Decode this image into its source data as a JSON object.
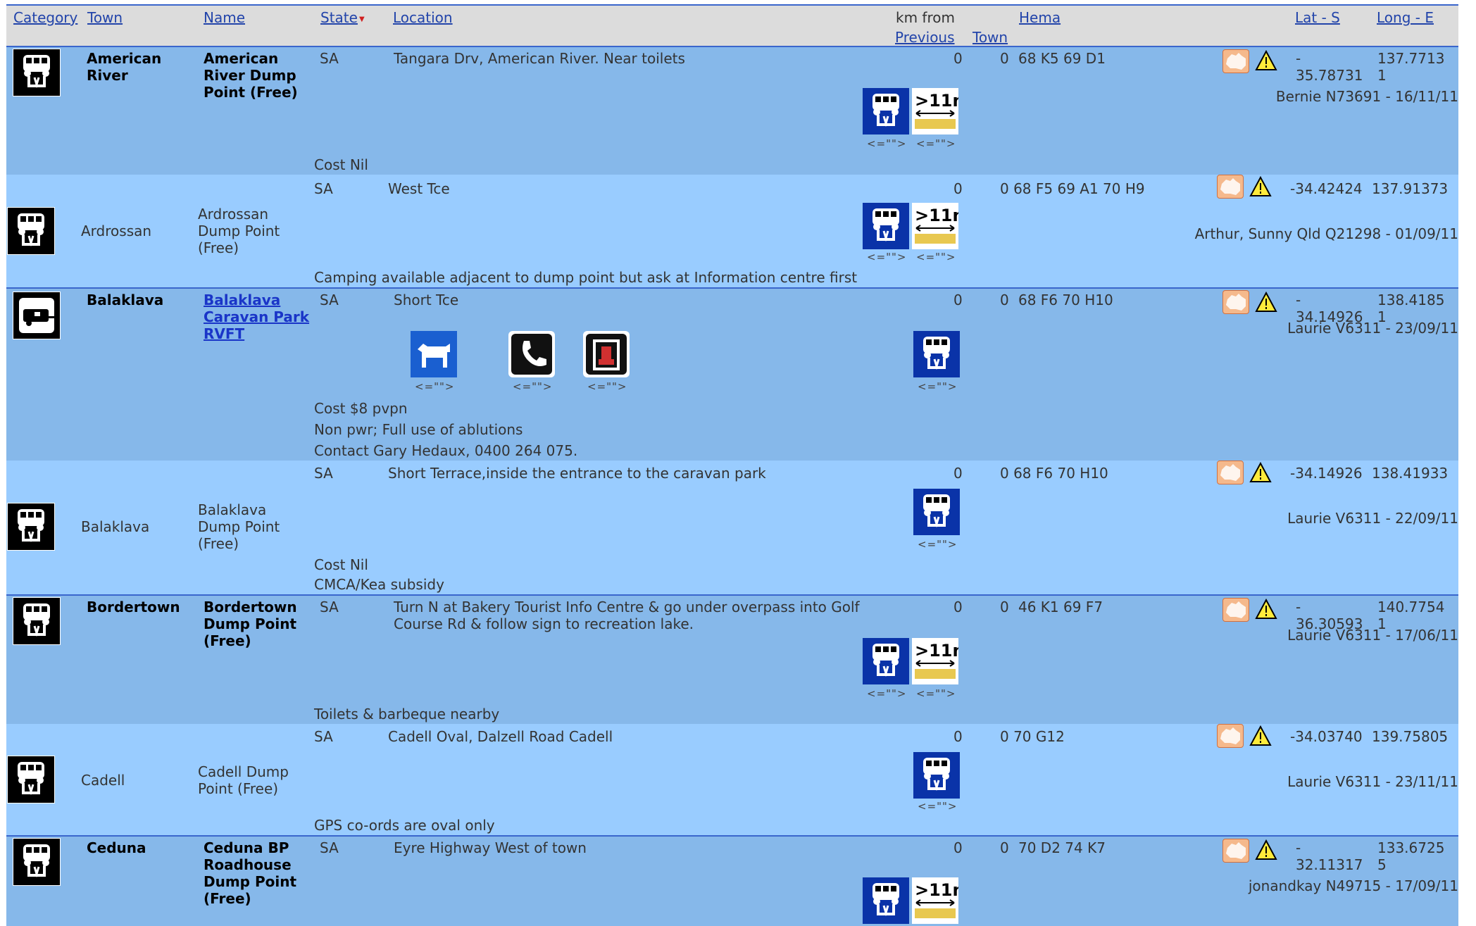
{
  "header": {
    "category": "Category",
    "town": "Town",
    "name": "Name",
    "state": "State",
    "location": "Location",
    "km_from": "km from",
    "previous": "Previous",
    "town2": "Town",
    "hema": "Hema",
    "lat": "Lat - S",
    "long": "Long - E"
  },
  "icon_caption": "<=\"\">",
  "rows": [
    {
      "town": "American River",
      "name": "American River Dump Point (Free)",
      "state": "SA",
      "location": "Tangara Drv, American River. Near toilets",
      "km": "0",
      "prev": "0",
      "hema": "68 K5 69 D1",
      "lat": "-\n35.78731",
      "long": "137.7713\n1",
      "contributor": "Bernie N73691 - 16/11/11",
      "notes": [
        "Cost Nil"
      ]
    },
    {
      "town": "Ardrossan",
      "name": "Ardrossan Dump Point (Free)",
      "state": "SA",
      "location": "West Tce",
      "km": "0",
      "hema": "0 68 F5 69 A1 70 H9",
      "lat": "-34.42424",
      "long": "137.91373",
      "contributor": "Arthur, Sunny Qld Q21298 - 01/09/11",
      "notes": [
        "Camping available adjacent to dump point but ask at Information centre first"
      ]
    },
    {
      "town": "Balaklava",
      "name": "Balaklava Caravan Park RVFT",
      "state": "SA",
      "location": "Short Tce",
      "km": "0",
      "prev": "0",
      "hema": "68 F6 70 H10",
      "lat": "-\n34.14926",
      "long": "138.4185\n1",
      "contributor": "Laurie V6311 - 23/09/11",
      "notes": [
        "Cost $8 pvpn",
        "Non pwr;  Full use of ablutions",
        "Contact Gary Hedaux, 0400 264 075."
      ]
    },
    {
      "town": "Balaklava",
      "name": "Balaklava Dump Point (Free)",
      "state": "SA",
      "location": "Short Terrace,inside the entrance to the caravan park",
      "km": "0",
      "hema": "0 68 F6 70 H10",
      "lat": "-34.14926",
      "long": "138.41933",
      "contributor": "Laurie V6311 - 22/09/11",
      "notes": [
        "Cost Nil",
        "CMCA/Kea subsidy"
      ]
    },
    {
      "town": "Bordertown",
      "name": "Bordertown Dump Point (Free)",
      "state": "SA",
      "location": "Turn N at Bakery Tourist Info Centre & go under overpass into Golf Course Rd & follow sign to recreation lake.",
      "km": "0",
      "prev": "0",
      "hema": "46 K1 69 F7",
      "lat": "-\n36.30593",
      "long": "140.7754\n1",
      "contributor": "Laurie V6311 - 17/06/11",
      "notes": [
        "Toilets & barbeque nearby"
      ]
    },
    {
      "town": "Cadell",
      "name": "Cadell Dump Point (Free)",
      "state": "SA",
      "location": "Cadell Oval, Dalzell Road Cadell",
      "km": "0",
      "hema": "0 70 G12",
      "lat": "-34.03740",
      "long": "139.75805",
      "contributor": "Laurie V6311 - 23/11/11",
      "notes": [
        "GPS co-ords are oval only"
      ]
    },
    {
      "town": "Ceduna",
      "name": "Ceduna BP Roadhouse Dump Point (Free)",
      "state": "SA",
      "location": "Eyre Highway West of town",
      "km": "0",
      "prev": "0",
      "hema": "70 D2 74 K7",
      "lat": "-\n32.11317",
      "long": "133.6725\n5",
      "contributor": "jonandkay N49715 - 17/09/11",
      "notes": []
    }
  ],
  "colors": {
    "row_dark": "#86b8ea",
    "row_light": "#99ccff",
    "link": "#2244aa",
    "icon_blue": "#0a33a8"
  }
}
